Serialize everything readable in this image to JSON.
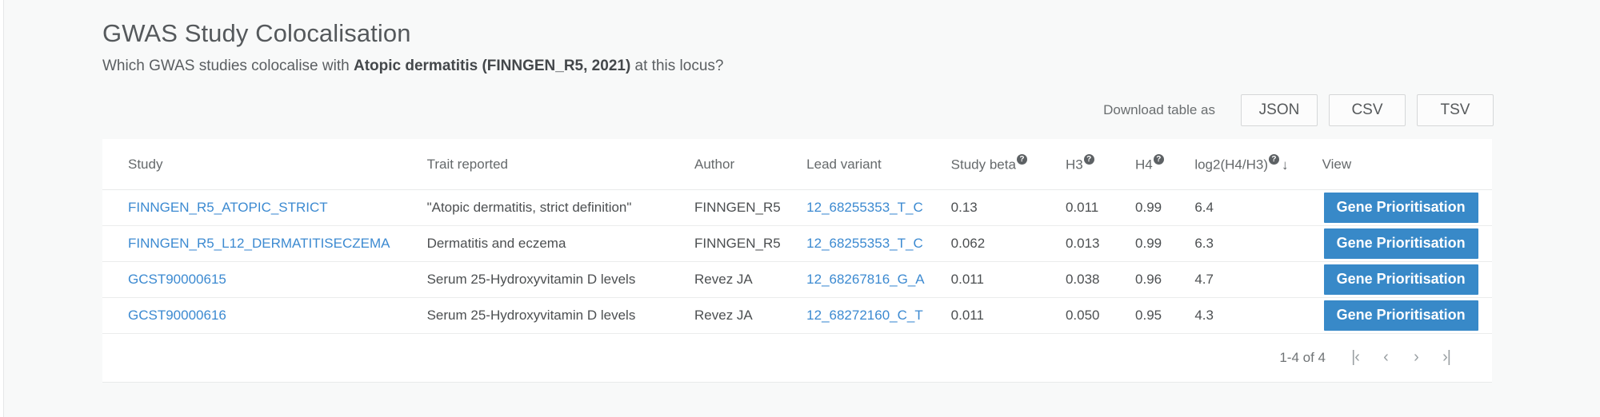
{
  "header": {
    "title": "GWAS Study Colocalisation",
    "subtitle_prefix": "Which GWAS studies colocalise with ",
    "subtitle_bold": "Atopic dermatitis (FINNGEN_R5, 2021)",
    "subtitle_suffix": " at this locus?"
  },
  "download": {
    "label": "Download table as",
    "buttons": [
      {
        "label": "JSON",
        "name": "download-json-button"
      },
      {
        "label": "CSV",
        "name": "download-csv-button"
      },
      {
        "label": "TSV",
        "name": "download-tsv-button"
      }
    ]
  },
  "table": {
    "columns": [
      {
        "key": "study",
        "label": "Study",
        "help": false,
        "sorted": false
      },
      {
        "key": "trait",
        "label": "Trait reported",
        "help": false,
        "sorted": false
      },
      {
        "key": "author",
        "label": "Author",
        "help": false,
        "sorted": false
      },
      {
        "key": "variant",
        "label": "Lead variant",
        "help": false,
        "sorted": false
      },
      {
        "key": "beta",
        "label": "Study beta",
        "help": true,
        "sorted": false
      },
      {
        "key": "h3",
        "label": "H3",
        "help": true,
        "sorted": false
      },
      {
        "key": "h4",
        "label": "H4",
        "help": true,
        "sorted": false
      },
      {
        "key": "log2",
        "label": "log2(H4/H3)",
        "help": true,
        "sorted": true
      },
      {
        "key": "view",
        "label": "View",
        "help": false,
        "sorted": false
      }
    ],
    "help_glyph": "?",
    "sort_glyph": "↓",
    "rows": [
      {
        "study": "FINNGEN_R5_ATOPIC_STRICT",
        "trait": "\"Atopic dermatitis, strict definition\"",
        "author": "FINNGEN_R5",
        "variant": "12_68255353_T_C",
        "beta": "0.13",
        "h3": "0.011",
        "h4": "0.99",
        "log2": "6.4",
        "view": "Gene Prioritisation"
      },
      {
        "study": "FINNGEN_R5_L12_DERMATITISECZEMA",
        "trait": "Dermatitis and eczema",
        "author": "FINNGEN_R5",
        "variant": "12_68255353_T_C",
        "beta": "0.062",
        "h3": "0.013",
        "h4": "0.99",
        "log2": "6.3",
        "view": "Gene Prioritisation"
      },
      {
        "study": "GCST90000615",
        "trait": "Serum 25-Hydroxyvitamin D levels",
        "author": "Revez JA",
        "variant": "12_68267816_G_A",
        "beta": "0.011",
        "h3": "0.038",
        "h4": "0.96",
        "log2": "4.7",
        "view": "Gene Prioritisation"
      },
      {
        "study": "GCST90000616",
        "trait": "Serum 25-Hydroxyvitamin D levels",
        "author": "Revez JA",
        "variant": "12_68272160_C_T",
        "beta": "0.011",
        "h3": "0.050",
        "h4": "0.95",
        "log2": "4.3",
        "view": "Gene Prioritisation"
      }
    ]
  },
  "pagination": {
    "range_text": "1-4 of 4",
    "first_glyph": "|‹",
    "prev_glyph": "‹",
    "next_glyph": "›",
    "last_glyph": "›|"
  },
  "colors": {
    "link": "#3c8ad1",
    "button_primary": "#3889c8",
    "page_background": "#f8f9f9"
  }
}
